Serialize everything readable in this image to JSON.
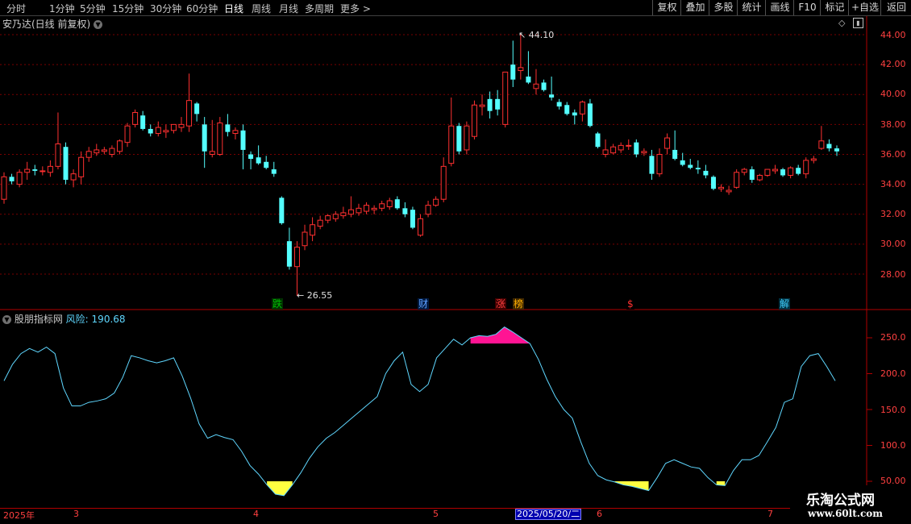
{
  "toolbar": {
    "periods": [
      "分时",
      "1分钟",
      "5分钟",
      "15分钟",
      "30分钟",
      "60分钟",
      "日线",
      "周线",
      "月线",
      "多周期",
      "更多"
    ],
    "active_period": "日线",
    "buttons": [
      "复权",
      "叠加",
      "多股",
      "统计",
      "画线",
      "F10",
      "标记",
      "+自选",
      "返回"
    ]
  },
  "main": {
    "stock_title": "安乃达(日线 前复权)",
    "price_axis": [
      "44.00",
      "42.00",
      "40.00",
      "38.00",
      "36.00",
      "34.00",
      "32.00",
      "30.00",
      "28.00"
    ],
    "high_label": "44.10",
    "low_label": "26.55",
    "markers": [
      {
        "text": "跌",
        "color": "#00c000",
        "bg": "#003000"
      },
      {
        "text": "财",
        "color": "#5fa0ff",
        "bg": "#001a40"
      },
      {
        "text": "涨",
        "color": "#ff4040",
        "bg": "#400000"
      },
      {
        "text": "榜",
        "color": "#ffb000",
        "bg": "#402800"
      },
      {
        "text": "$",
        "color": "#ff3030",
        "bg": "#000000"
      },
      {
        "text": "解",
        "color": "#40d0ff",
        "bg": "#003040"
      }
    ]
  },
  "indicator": {
    "name": "股朋指标网",
    "series_label": "风险:",
    "value": "190.68",
    "axis": [
      "250.0",
      "200.0",
      "150.0",
      "100.0",
      "50.00"
    ]
  },
  "dates": {
    "labels": [
      "2025年",
      "3",
      "4",
      "5",
      "6",
      "7"
    ],
    "selected": "2025/05/20/二"
  },
  "watermark": {
    "title": "乐淘公式网",
    "url": "www.60lt.com"
  },
  "colors": {
    "up": "#ff3030",
    "down": "#54ffff",
    "risk_line": "#5fd7ff",
    "low_fill": "#ffff40",
    "high_fill": "#ff1493"
  },
  "chart_data": {
    "type": "candlestick",
    "ylim": [
      26.0,
      44.5
    ],
    "candles": [
      {
        "o": 33.0,
        "h": 34.8,
        "l": 32.7,
        "c": 34.5
      },
      {
        "o": 34.5,
        "h": 34.7,
        "l": 34.0,
        "c": 34.2
      },
      {
        "o": 34.0,
        "h": 35.0,
        "l": 33.8,
        "c": 34.8
      },
      {
        "o": 34.8,
        "h": 35.5,
        "l": 34.3,
        "c": 35.0
      },
      {
        "o": 35.0,
        "h": 35.3,
        "l": 34.6,
        "c": 34.9
      },
      {
        "o": 34.9,
        "h": 35.2,
        "l": 34.6,
        "c": 34.9
      },
      {
        "o": 34.8,
        "h": 35.6,
        "l": 34.5,
        "c": 35.2
      },
      {
        "o": 35.2,
        "h": 38.8,
        "l": 35.0,
        "c": 36.7
      },
      {
        "o": 36.5,
        "h": 36.8,
        "l": 34.0,
        "c": 34.3
      },
      {
        "o": 34.3,
        "h": 35.0,
        "l": 33.8,
        "c": 34.7
      },
      {
        "o": 34.5,
        "h": 36.2,
        "l": 34.0,
        "c": 35.8
      },
      {
        "o": 35.8,
        "h": 36.5,
        "l": 35.5,
        "c": 36.2
      },
      {
        "o": 36.1,
        "h": 36.7,
        "l": 35.9,
        "c": 36.3
      },
      {
        "o": 36.2,
        "h": 36.5,
        "l": 36.0,
        "c": 36.3
      },
      {
        "o": 36.0,
        "h": 36.6,
        "l": 35.8,
        "c": 36.4
      },
      {
        "o": 36.2,
        "h": 37.0,
        "l": 36.0,
        "c": 36.9
      },
      {
        "o": 36.8,
        "h": 38.1,
        "l": 36.5,
        "c": 37.9
      },
      {
        "o": 38.0,
        "h": 39.0,
        "l": 37.8,
        "c": 38.8
      },
      {
        "o": 38.6,
        "h": 38.9,
        "l": 37.6,
        "c": 37.7
      },
      {
        "o": 37.7,
        "h": 38.0,
        "l": 37.2,
        "c": 37.4
      },
      {
        "o": 37.4,
        "h": 38.2,
        "l": 37.2,
        "c": 37.8
      },
      {
        "o": 37.5,
        "h": 38.0,
        "l": 37.1,
        "c": 37.6
      },
      {
        "o": 37.6,
        "h": 38.0,
        "l": 37.4,
        "c": 38.0
      },
      {
        "o": 37.8,
        "h": 38.5,
        "l": 37.5,
        "c": 38.0
      },
      {
        "o": 37.9,
        "h": 41.4,
        "l": 37.5,
        "c": 39.6
      },
      {
        "o": 39.4,
        "h": 39.5,
        "l": 38.2,
        "c": 38.7
      },
      {
        "o": 38.0,
        "h": 38.5,
        "l": 35.1,
        "c": 36.2
      },
      {
        "o": 36.0,
        "h": 38.3,
        "l": 35.8,
        "c": 36.2
      },
      {
        "o": 36.0,
        "h": 38.5,
        "l": 35.9,
        "c": 38.1
      },
      {
        "o": 38.0,
        "h": 38.7,
        "l": 37.2,
        "c": 37.5
      },
      {
        "o": 37.4,
        "h": 37.8,
        "l": 37.0,
        "c": 37.6
      },
      {
        "o": 37.6,
        "h": 38.0,
        "l": 35.0,
        "c": 36.3
      },
      {
        "o": 36.0,
        "h": 36.2,
        "l": 35.0,
        "c": 35.7
      },
      {
        "o": 35.8,
        "h": 36.6,
        "l": 35.3,
        "c": 35.4
      },
      {
        "o": 35.5,
        "h": 35.9,
        "l": 35.0,
        "c": 35.1
      },
      {
        "o": 35.0,
        "h": 35.5,
        "l": 34.5,
        "c": 34.7
      },
      {
        "o": 33.1,
        "h": 33.2,
        "l": 31.3,
        "c": 31.4
      },
      {
        "o": 30.2,
        "h": 31.1,
        "l": 28.3,
        "c": 28.5
      },
      {
        "o": 28.5,
        "h": 30.2,
        "l": 26.55,
        "c": 29.8
      },
      {
        "o": 29.9,
        "h": 31.3,
        "l": 29.6,
        "c": 30.8
      },
      {
        "o": 30.6,
        "h": 31.8,
        "l": 30.2,
        "c": 31.3
      },
      {
        "o": 31.2,
        "h": 31.9,
        "l": 31.0,
        "c": 31.6
      },
      {
        "o": 31.6,
        "h": 32.0,
        "l": 31.4,
        "c": 31.9
      },
      {
        "o": 31.7,
        "h": 32.2,
        "l": 31.5,
        "c": 32.0
      },
      {
        "o": 31.9,
        "h": 32.5,
        "l": 31.7,
        "c": 32.1
      },
      {
        "o": 32.0,
        "h": 33.2,
        "l": 31.8,
        "c": 32.3
      },
      {
        "o": 32.1,
        "h": 32.7,
        "l": 31.9,
        "c": 32.4
      },
      {
        "o": 32.2,
        "h": 32.8,
        "l": 32.0,
        "c": 32.6
      },
      {
        "o": 32.3,
        "h": 32.6,
        "l": 32.0,
        "c": 32.4
      },
      {
        "o": 32.4,
        "h": 32.9,
        "l": 32.2,
        "c": 32.7
      },
      {
        "o": 32.5,
        "h": 33.1,
        "l": 32.3,
        "c": 32.9
      },
      {
        "o": 33.0,
        "h": 33.2,
        "l": 32.3,
        "c": 32.4
      },
      {
        "o": 32.4,
        "h": 32.8,
        "l": 31.8,
        "c": 32.0
      },
      {
        "o": 32.3,
        "h": 32.5,
        "l": 31.0,
        "c": 31.1
      },
      {
        "o": 30.6,
        "h": 32.0,
        "l": 30.5,
        "c": 31.7
      },
      {
        "o": 32.0,
        "h": 32.9,
        "l": 31.8,
        "c": 32.6
      },
      {
        "o": 32.6,
        "h": 33.2,
        "l": 32.5,
        "c": 33.0
      },
      {
        "o": 33.0,
        "h": 35.8,
        "l": 32.8,
        "c": 35.2
      },
      {
        "o": 35.4,
        "h": 39.8,
        "l": 35.2,
        "c": 37.9
      },
      {
        "o": 37.9,
        "h": 38.1,
        "l": 36.0,
        "c": 36.2
      },
      {
        "o": 36.3,
        "h": 38.2,
        "l": 36.0,
        "c": 37.9
      },
      {
        "o": 37.2,
        "h": 39.6,
        "l": 37.0,
        "c": 39.3
      },
      {
        "o": 39.2,
        "h": 40.0,
        "l": 38.6,
        "c": 39.3
      },
      {
        "o": 39.7,
        "h": 40.2,
        "l": 38.4,
        "c": 38.9
      },
      {
        "o": 39.7,
        "h": 40.3,
        "l": 38.6,
        "c": 39.0
      },
      {
        "o": 38.0,
        "h": 41.0,
        "l": 37.8,
        "c": 41.5
      },
      {
        "o": 42.0,
        "h": 43.6,
        "l": 40.5,
        "c": 41.0
      },
      {
        "o": 41.6,
        "h": 44.1,
        "l": 41.0,
        "c": 41.8
      },
      {
        "o": 41.2,
        "h": 42.9,
        "l": 40.7,
        "c": 40.8
      },
      {
        "o": 40.4,
        "h": 41.7,
        "l": 40.0,
        "c": 40.7
      },
      {
        "o": 40.8,
        "h": 41.0,
        "l": 40.2,
        "c": 40.3
      },
      {
        "o": 40.0,
        "h": 41.2,
        "l": 39.6,
        "c": 39.8
      },
      {
        "o": 39.5,
        "h": 39.7,
        "l": 39.0,
        "c": 39.2
      },
      {
        "o": 39.3,
        "h": 39.5,
        "l": 38.6,
        "c": 38.7
      },
      {
        "o": 38.8,
        "h": 39.0,
        "l": 38.0,
        "c": 38.6
      },
      {
        "o": 38.7,
        "h": 39.6,
        "l": 38.2,
        "c": 39.5
      },
      {
        "o": 39.4,
        "h": 39.7,
        "l": 37.8,
        "c": 37.9
      },
      {
        "o": 37.4,
        "h": 37.5,
        "l": 36.4,
        "c": 36.5
      },
      {
        "o": 36.0,
        "h": 37.0,
        "l": 35.8,
        "c": 36.3
      },
      {
        "o": 36.1,
        "h": 36.7,
        "l": 36.0,
        "c": 36.5
      },
      {
        "o": 36.3,
        "h": 36.8,
        "l": 36.1,
        "c": 36.6
      },
      {
        "o": 36.6,
        "h": 37.0,
        "l": 36.3,
        "c": 36.6
      },
      {
        "o": 36.8,
        "h": 37.0,
        "l": 35.8,
        "c": 36.0
      },
      {
        "o": 36.1,
        "h": 36.4,
        "l": 35.9,
        "c": 36.2
      },
      {
        "o": 35.9,
        "h": 36.3,
        "l": 34.3,
        "c": 34.7
      },
      {
        "o": 34.7,
        "h": 36.4,
        "l": 34.5,
        "c": 36.0
      },
      {
        "o": 36.4,
        "h": 37.4,
        "l": 36.0,
        "c": 37.1
      },
      {
        "o": 36.3,
        "h": 37.6,
        "l": 35.6,
        "c": 35.7
      },
      {
        "o": 35.6,
        "h": 36.1,
        "l": 35.2,
        "c": 35.3
      },
      {
        "o": 35.3,
        "h": 35.7,
        "l": 35.0,
        "c": 35.1
      },
      {
        "o": 35.1,
        "h": 35.6,
        "l": 34.7,
        "c": 35.0
      },
      {
        "o": 34.9,
        "h": 35.3,
        "l": 34.4,
        "c": 34.6
      },
      {
        "o": 34.5,
        "h": 34.6,
        "l": 33.6,
        "c": 33.7
      },
      {
        "o": 33.7,
        "h": 34.0,
        "l": 33.5,
        "c": 33.8
      },
      {
        "o": 33.5,
        "h": 33.9,
        "l": 33.3,
        "c": 33.6
      },
      {
        "o": 33.8,
        "h": 35.0,
        "l": 33.7,
        "c": 34.8
      },
      {
        "o": 34.8,
        "h": 35.1,
        "l": 34.6,
        "c": 35.0
      },
      {
        "o": 35.0,
        "h": 35.2,
        "l": 34.1,
        "c": 34.3
      },
      {
        "o": 34.3,
        "h": 34.7,
        "l": 34.2,
        "c": 34.6
      },
      {
        "o": 34.6,
        "h": 35.0,
        "l": 34.5,
        "c": 35.0
      },
      {
        "o": 34.9,
        "h": 35.3,
        "l": 34.7,
        "c": 35.0
      },
      {
        "o": 35.0,
        "h": 35.1,
        "l": 34.5,
        "c": 34.6
      },
      {
        "o": 34.6,
        "h": 35.2,
        "l": 34.4,
        "c": 35.1
      },
      {
        "o": 35.1,
        "h": 35.3,
        "l": 34.6,
        "c": 34.7
      },
      {
        "o": 34.7,
        "h": 35.8,
        "l": 34.4,
        "c": 35.6
      },
      {
        "o": 35.6,
        "h": 35.9,
        "l": 35.4,
        "c": 35.7
      },
      {
        "o": 36.4,
        "h": 37.9,
        "l": 36.3,
        "c": 36.9
      },
      {
        "o": 36.7,
        "h": 37.0,
        "l": 36.2,
        "c": 36.4
      },
      {
        "o": 36.4,
        "h": 36.6,
        "l": 35.9,
        "c": 36.2
      }
    ],
    "risk": [
      190,
      213,
      228,
      235,
      230,
      237,
      228,
      180,
      155,
      155,
      160,
      162,
      165,
      173,
      195,
      225,
      222,
      218,
      215,
      218,
      222,
      197,
      166,
      130,
      110,
      115,
      111,
      108,
      92,
      72,
      60,
      45,
      32,
      30,
      45,
      62,
      82,
      98,
      110,
      118,
      128,
      138,
      148,
      158,
      168,
      200,
      218,
      230,
      185,
      175,
      185,
      222,
      235,
      248,
      240,
      250,
      253,
      252,
      255,
      265,
      258,
      250,
      242,
      220,
      192,
      168,
      150,
      138,
      105,
      75,
      58,
      52,
      49,
      45,
      43,
      40,
      37,
      55,
      75,
      80,
      75,
      70,
      68,
      55,
      45,
      44,
      65,
      80,
      80,
      86,
      105,
      125,
      160,
      165,
      210,
      225,
      228,
      210,
      190
    ]
  }
}
